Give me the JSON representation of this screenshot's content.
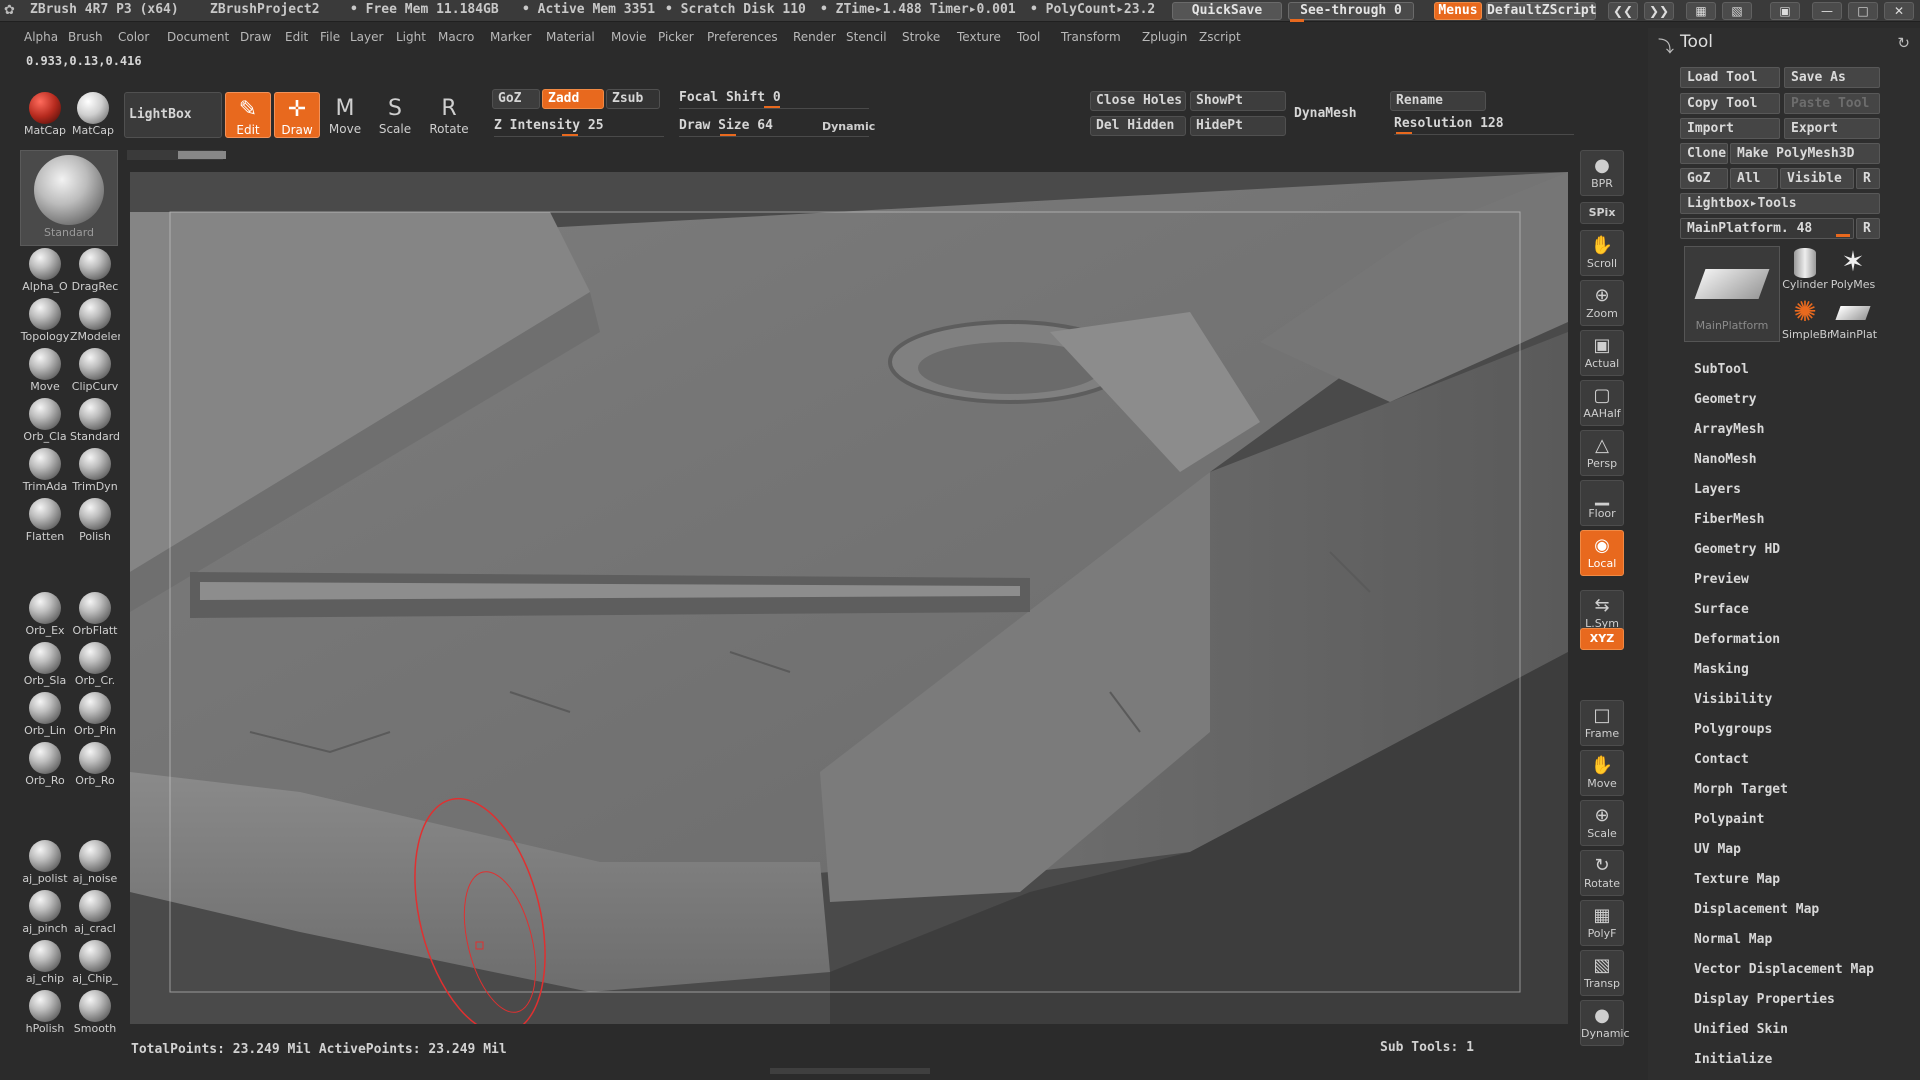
{
  "titlebar": {
    "app": "ZBrush 4R7 P3 (x64)",
    "project": "ZBrushProject2",
    "free_mem": "• Free Mem 11.184GB",
    "active_mem": "• Active Mem 3351",
    "scratch": "• Scratch Disk 110",
    "ztime": "• ZTime▸1.488 Timer▸0.001",
    "polycount": "• PolyCount▸23.2",
    "quicksave": "QuickSave",
    "see_through": "See-through  0",
    "menus": "Menus",
    "script": "DefaultZScript"
  },
  "menu": [
    "Alpha",
    "Brush",
    "Color",
    "Document",
    "Draw",
    "Edit",
    "File",
    "Layer",
    "Light",
    "Macro",
    "Marker",
    "Material",
    "Movie",
    "Picker",
    "Preferences",
    "Render",
    "Stencil",
    "Stroke",
    "Texture",
    "Tool",
    "Transform",
    "Zplugin",
    "Zscript"
  ],
  "coords": "0.933,0.13,0.416",
  "shelf": {
    "matcap1": "MatCap",
    "matcap2": "MatCap",
    "lightbox": "LightBox",
    "edit": "Edit",
    "draw": "Draw",
    "move": "Move",
    "scale": "Scale",
    "rotate": "Rotate",
    "goz": "GoZ",
    "zadd": "Zadd",
    "zsub": "Zsub",
    "z_intensity": "Z Intensity 25",
    "focal_shift": "Focal Shift 0",
    "draw_size": "Draw Size 64",
    "dynamic": "Dynamic",
    "close_holes": "Close Holes",
    "show_pt": "ShowPt",
    "del_hidden": "Del Hidden",
    "hide_pt": "HidePt",
    "dynamesh": "DynaMesh",
    "rename": "Rename",
    "resolution": "Resolution 128"
  },
  "left_tray": {
    "standard": "Standard",
    "brushes": [
      [
        "Alpha_O",
        "DragRec"
      ],
      [
        "Topology",
        "ZModeler"
      ],
      [
        "Move",
        "ClipCurv"
      ],
      [
        "Orb_Cla",
        "Standard"
      ],
      [
        "TrimAda",
        "TrimDyn"
      ],
      [
        "Flatten",
        "Polish"
      ],
      [
        "Orb_Ex",
        "OrbFlatt"
      ],
      [
        "Orb_Sla",
        "Orb_Cr."
      ],
      [
        "Orb_Lin",
        "Orb_Pin"
      ],
      [
        "Orb_Ro",
        "Orb_Ro"
      ],
      [
        "aj_polist",
        "aj_noise"
      ],
      [
        "aj_pinch",
        "aj_cracl"
      ],
      [
        "aj_chip",
        "aj_Chip_"
      ],
      [
        "hPolish",
        "Smooth"
      ]
    ]
  },
  "status": {
    "points": "TotalPoints: 23.249 Mil ActivePoints: 23.249 Mil",
    "subtools": "Sub Tools: 1"
  },
  "view_tray": [
    "BPR",
    "SPix",
    "Scroll",
    "Zoom",
    "Actual",
    "AAHalf",
    "Persp",
    "Floor",
    "Local",
    "L.Sym",
    "XYZ",
    "Frame",
    "Move",
    "Scale",
    "Rotate",
    "PolyF",
    "Transp",
    "Dynamic"
  ],
  "tool_panel": {
    "title": "Tool",
    "load_tool": "Load Tool",
    "save_as": "Save As",
    "copy_tool": "Copy Tool",
    "paste_tool": "Paste Tool",
    "import": "Import",
    "export": "Export",
    "clone": "Clone",
    "make_polymesh": "Make PolyMesh3D",
    "goz": "GoZ",
    "all": "All",
    "visible": "Visible",
    "r": "R",
    "lightbox_tools": "Lightbox▸Tools",
    "main_platform": "MainPlatform. 48",
    "thumbs": [
      "MainPlatform",
      "Cylinder",
      "PolyMes",
      "SimpleBr",
      "MainPlat"
    ],
    "sections": [
      "SubTool",
      "Geometry",
      "ArrayMesh",
      "NanoMesh",
      "Layers",
      "FiberMesh",
      "Geometry HD",
      "Preview",
      "Surface",
      "Deformation",
      "Masking",
      "Visibility",
      "Polygroups",
      "Contact",
      "Morph Target",
      "Polypaint",
      "UV Map",
      "Texture Map",
      "Displacement Map",
      "Normal Map",
      "Vector Displacement Map",
      "Display Properties",
      "Unified Skin",
      "Initialize"
    ]
  },
  "colors": {
    "accent": "#e8691e",
    "background": "#2b2b2b",
    "viewport": "#4c4c4c"
  }
}
